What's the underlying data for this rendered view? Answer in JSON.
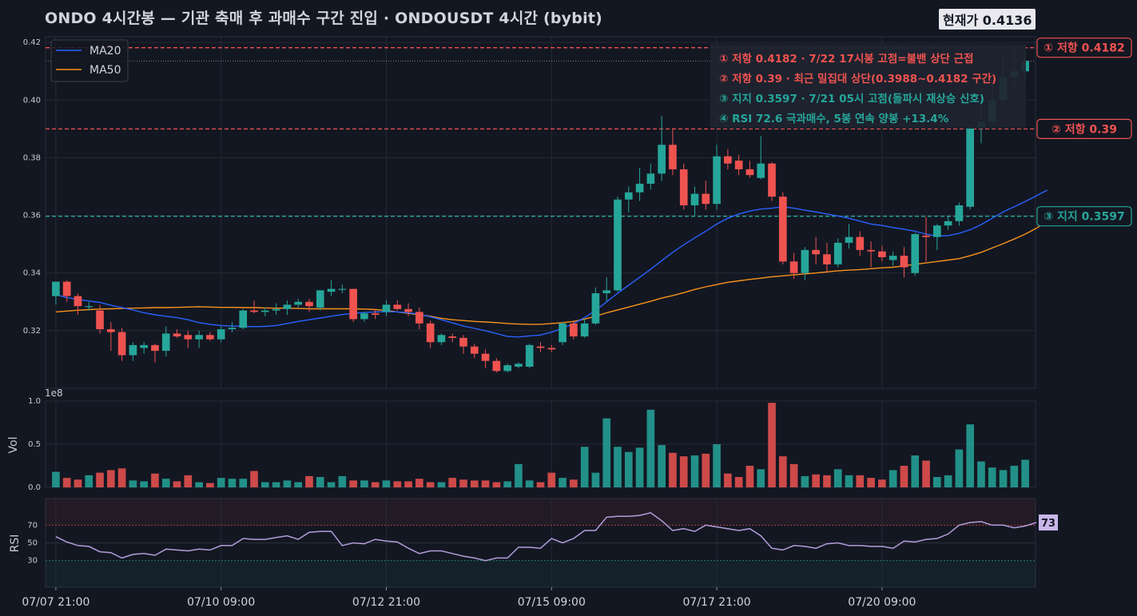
{
  "header": {
    "title": "ONDO 4시간봉 — 기관 축매 후 과매수 구간 진입   ·   ONDOUSDT 4시간 (bybit)",
    "current_price_label": "현재가 0.4136"
  },
  "colors": {
    "background": "#131722",
    "up": "#26a69a",
    "down": "#ef5350",
    "ma20": "#2962ff",
    "ma50": "#f7931a",
    "rsi_line": "#b39ddb",
    "resistance": "#ef5350",
    "support": "#26a69a"
  },
  "legend": {
    "ma20": "MA20",
    "ma50": "MA50"
  },
  "annotations": [
    {
      "text": "① 저항 0.4182 · 7/22 17시봉 고점=불밴 상단 근접",
      "color": "#ef5350"
    },
    {
      "text": "② 저항 0.39 · 최근 밀집대 상단(0.3988~0.4182 구간)",
      "color": "#ef5350"
    },
    {
      "text": "③ 지지 0.3597 · 7/21 05시 고점(돌파시 재상승 신호)",
      "color": "#26a69a"
    },
    {
      "text": "④ RSI 72.6 극과매수, 5봉 연속 양봉 +13.4%",
      "color": "#26a69a"
    }
  ],
  "level_labels": [
    {
      "text": "① 저항 0.4182",
      "value": 0.4182,
      "color": "#ef5350"
    },
    {
      "text": "② 저항 0.39",
      "value": 0.39,
      "color": "#ef5350"
    },
    {
      "text": "③ 지지 0.3597",
      "value": 0.3597,
      "color": "#26a69a"
    }
  ],
  "chart_data": {
    "type": "candlestick",
    "symbol": "ONDOUSDT",
    "timeframe": "4시간",
    "exchange": "bybit",
    "x_tick_labels": [
      "07/07 21:00",
      "07/10 09:00",
      "07/12 21:00",
      "07/15 09:00",
      "07/17 21:00",
      "07/20 09:00"
    ],
    "x_tick_indices": [
      0,
      15,
      30,
      45,
      60,
      75
    ],
    "price_axis": {
      "ylim": [
        0.3,
        0.422
      ],
      "ticks": [
        0.32,
        0.34,
        0.36,
        0.38,
        0.4,
        0.42
      ],
      "tick_labels": [
        "0.32",
        "0.34",
        "0.36",
        "0.38",
        "0.40",
        "0.42"
      ]
    },
    "volume_axis": {
      "label": "Vol",
      "multiplier_label": "1e8",
      "ylim": [
        0,
        1.0
      ],
      "ticks": [
        0,
        0.5,
        1.0
      ],
      "tick_labels": [
        "0.0",
        "0.5",
        "1.0"
      ]
    },
    "rsi_axis": {
      "label": "RSI",
      "ylim": [
        0,
        100
      ],
      "ticks": [
        30,
        50,
        70
      ],
      "tick_labels": [
        "30",
        "50",
        "70"
      ],
      "overbought": 70,
      "oversold": 30
    },
    "rsi_last_label": "73",
    "horizontal_levels": [
      {
        "value": 0.4182,
        "kind": "resistance"
      },
      {
        "value": 0.39,
        "kind": "resistance"
      },
      {
        "value": 0.3597,
        "kind": "support"
      }
    ],
    "candles": [
      {
        "o": 0.332,
        "h": 0.337,
        "l": 0.329,
        "c": 0.337
      },
      {
        "o": 0.337,
        "h": 0.3375,
        "l": 0.33,
        "c": 0.332
      },
      {
        "o": 0.332,
        "h": 0.333,
        "l": 0.3255,
        "c": 0.3285
      },
      {
        "o": 0.3285,
        "h": 0.33,
        "l": 0.327,
        "c": 0.3285
      },
      {
        "o": 0.327,
        "h": 0.329,
        "l": 0.319,
        "c": 0.3205
      },
      {
        "o": 0.3205,
        "h": 0.323,
        "l": 0.313,
        "c": 0.3195
      },
      {
        "o": 0.3195,
        "h": 0.321,
        "l": 0.3095,
        "c": 0.3115
      },
      {
        "o": 0.3115,
        "h": 0.316,
        "l": 0.3095,
        "c": 0.315
      },
      {
        "o": 0.314,
        "h": 0.316,
        "l": 0.312,
        "c": 0.315
      },
      {
        "o": 0.315,
        "h": 0.3155,
        "l": 0.309,
        "c": 0.313
      },
      {
        "o": 0.313,
        "h": 0.3215,
        "l": 0.311,
        "c": 0.319
      },
      {
        "o": 0.319,
        "h": 0.3205,
        "l": 0.3175,
        "c": 0.318
      },
      {
        "o": 0.3185,
        "h": 0.32,
        "l": 0.314,
        "c": 0.317
      },
      {
        "o": 0.317,
        "h": 0.32,
        "l": 0.314,
        "c": 0.3185
      },
      {
        "o": 0.3185,
        "h": 0.3195,
        "l": 0.3165,
        "c": 0.317
      },
      {
        "o": 0.317,
        "h": 0.3215,
        "l": 0.316,
        "c": 0.3205
      },
      {
        "o": 0.3205,
        "h": 0.323,
        "l": 0.3195,
        "c": 0.321
      },
      {
        "o": 0.321,
        "h": 0.3275,
        "l": 0.3205,
        "c": 0.327
      },
      {
        "o": 0.327,
        "h": 0.3305,
        "l": 0.326,
        "c": 0.3265
      },
      {
        "o": 0.3265,
        "h": 0.328,
        "l": 0.325,
        "c": 0.327
      },
      {
        "o": 0.327,
        "h": 0.3295,
        "l": 0.3255,
        "c": 0.3275
      },
      {
        "o": 0.3275,
        "h": 0.3305,
        "l": 0.3255,
        "c": 0.329
      },
      {
        "o": 0.329,
        "h": 0.331,
        "l": 0.328,
        "c": 0.33
      },
      {
        "o": 0.33,
        "h": 0.331,
        "l": 0.3265,
        "c": 0.3285
      },
      {
        "o": 0.328,
        "h": 0.334,
        "l": 0.327,
        "c": 0.334
      },
      {
        "o": 0.3335,
        "h": 0.3375,
        "l": 0.332,
        "c": 0.3345
      },
      {
        "o": 0.3345,
        "h": 0.336,
        "l": 0.333,
        "c": 0.3345
      },
      {
        "o": 0.3345,
        "h": 0.3345,
        "l": 0.323,
        "c": 0.324
      },
      {
        "o": 0.324,
        "h": 0.3265,
        "l": 0.323,
        "c": 0.326
      },
      {
        "o": 0.326,
        "h": 0.3275,
        "l": 0.324,
        "c": 0.3255
      },
      {
        "o": 0.3265,
        "h": 0.3305,
        "l": 0.325,
        "c": 0.329
      },
      {
        "o": 0.329,
        "h": 0.3305,
        "l": 0.327,
        "c": 0.3275
      },
      {
        "o": 0.3275,
        "h": 0.3295,
        "l": 0.325,
        "c": 0.3265
      },
      {
        "o": 0.3265,
        "h": 0.328,
        "l": 0.3205,
        "c": 0.3225
      },
      {
        "o": 0.3225,
        "h": 0.3235,
        "l": 0.314,
        "c": 0.316
      },
      {
        "o": 0.316,
        "h": 0.319,
        "l": 0.315,
        "c": 0.3185
      },
      {
        "o": 0.318,
        "h": 0.319,
        "l": 0.316,
        "c": 0.3175
      },
      {
        "o": 0.3175,
        "h": 0.3185,
        "l": 0.312,
        "c": 0.3145
      },
      {
        "o": 0.3145,
        "h": 0.3155,
        "l": 0.3105,
        "c": 0.312
      },
      {
        "o": 0.312,
        "h": 0.3135,
        "l": 0.307,
        "c": 0.3095
      },
      {
        "o": 0.3095,
        "h": 0.3105,
        "l": 0.3055,
        "c": 0.306
      },
      {
        "o": 0.306,
        "h": 0.3085,
        "l": 0.3055,
        "c": 0.308
      },
      {
        "o": 0.3075,
        "h": 0.309,
        "l": 0.307,
        "c": 0.3085
      },
      {
        "o": 0.3075,
        "h": 0.3155,
        "l": 0.307,
        "c": 0.315
      },
      {
        "o": 0.3145,
        "h": 0.316,
        "l": 0.3125,
        "c": 0.314
      },
      {
        "o": 0.314,
        "h": 0.315,
        "l": 0.3125,
        "c": 0.3135
      },
      {
        "o": 0.316,
        "h": 0.323,
        "l": 0.315,
        "c": 0.3225
      },
      {
        "o": 0.3225,
        "h": 0.3235,
        "l": 0.317,
        "c": 0.318
      },
      {
        "o": 0.318,
        "h": 0.324,
        "l": 0.3175,
        "c": 0.3225
      },
      {
        "o": 0.3225,
        "h": 0.335,
        "l": 0.322,
        "c": 0.333
      },
      {
        "o": 0.333,
        "h": 0.3385,
        "l": 0.33,
        "c": 0.334
      },
      {
        "o": 0.334,
        "h": 0.3665,
        "l": 0.3335,
        "c": 0.3655
      },
      {
        "o": 0.3655,
        "h": 0.37,
        "l": 0.361,
        "c": 0.368
      },
      {
        "o": 0.368,
        "h": 0.3765,
        "l": 0.365,
        "c": 0.371
      },
      {
        "o": 0.371,
        "h": 0.378,
        "l": 0.369,
        "c": 0.3745
      },
      {
        "o": 0.3745,
        "h": 0.3945,
        "l": 0.372,
        "c": 0.3845
      },
      {
        "o": 0.3845,
        "h": 0.39,
        "l": 0.374,
        "c": 0.376
      },
      {
        "o": 0.376,
        "h": 0.378,
        "l": 0.362,
        "c": 0.3635
      },
      {
        "o": 0.3635,
        "h": 0.37,
        "l": 0.36,
        "c": 0.3675
      },
      {
        "o": 0.3675,
        "h": 0.372,
        "l": 0.362,
        "c": 0.364
      },
      {
        "o": 0.364,
        "h": 0.3845,
        "l": 0.362,
        "c": 0.3805
      },
      {
        "o": 0.3805,
        "h": 0.383,
        "l": 0.376,
        "c": 0.378
      },
      {
        "o": 0.379,
        "h": 0.381,
        "l": 0.374,
        "c": 0.376
      },
      {
        "o": 0.376,
        "h": 0.379,
        "l": 0.373,
        "c": 0.374
      },
      {
        "o": 0.373,
        "h": 0.3875,
        "l": 0.3725,
        "c": 0.378
      },
      {
        "o": 0.378,
        "h": 0.3785,
        "l": 0.365,
        "c": 0.3665
      },
      {
        "o": 0.3665,
        "h": 0.368,
        "l": 0.343,
        "c": 0.344
      },
      {
        "o": 0.344,
        "h": 0.347,
        "l": 0.338,
        "c": 0.34
      },
      {
        "o": 0.34,
        "h": 0.349,
        "l": 0.3375,
        "c": 0.348
      },
      {
        "o": 0.348,
        "h": 0.3525,
        "l": 0.343,
        "c": 0.3465
      },
      {
        "o": 0.3465,
        "h": 0.3505,
        "l": 0.34,
        "c": 0.343
      },
      {
        "o": 0.343,
        "h": 0.352,
        "l": 0.342,
        "c": 0.3505
      },
      {
        "o": 0.3505,
        "h": 0.357,
        "l": 0.3485,
        "c": 0.3525
      },
      {
        "o": 0.3525,
        "h": 0.3545,
        "l": 0.346,
        "c": 0.348
      },
      {
        "o": 0.348,
        "h": 0.351,
        "l": 0.342,
        "c": 0.3475
      },
      {
        "o": 0.3475,
        "h": 0.3495,
        "l": 0.344,
        "c": 0.3455
      },
      {
        "o": 0.3445,
        "h": 0.3475,
        "l": 0.3425,
        "c": 0.346
      },
      {
        "o": 0.346,
        "h": 0.349,
        "l": 0.3385,
        "c": 0.342
      },
      {
        "o": 0.34,
        "h": 0.354,
        "l": 0.339,
        "c": 0.3535
      },
      {
        "o": 0.353,
        "h": 0.3595,
        "l": 0.344,
        "c": 0.3525
      },
      {
        "o": 0.3525,
        "h": 0.357,
        "l": 0.348,
        "c": 0.3565
      },
      {
        "o": 0.3565,
        "h": 0.36,
        "l": 0.355,
        "c": 0.358
      },
      {
        "o": 0.358,
        "h": 0.3645,
        "l": 0.3565,
        "c": 0.3635
      },
      {
        "o": 0.363,
        "h": 0.391,
        "l": 0.362,
        "c": 0.3905
      },
      {
        "o": 0.3905,
        "h": 0.399,
        "l": 0.385,
        "c": 0.3925
      },
      {
        "o": 0.3925,
        "h": 0.406,
        "l": 0.39,
        "c": 0.4
      },
      {
        "o": 0.4,
        "h": 0.416,
        "l": 0.399,
        "c": 0.408
      },
      {
        "o": 0.408,
        "h": 0.4182,
        "l": 0.404,
        "c": 0.41
      },
      {
        "o": 0.41,
        "h": 0.417,
        "l": 0.406,
        "c": 0.4136
      }
    ],
    "ma20": [
      0.3325,
      0.3315,
      0.3308,
      0.3303,
      0.3298,
      0.3288,
      0.328,
      0.3272,
      0.3262,
      0.3255,
      0.325,
      0.3245,
      0.3238,
      0.3228,
      0.3222,
      0.3218,
      0.3216,
      0.3215,
      0.3214,
      0.3215,
      0.3218,
      0.3225,
      0.3232,
      0.3238,
      0.3244,
      0.325,
      0.3256,
      0.326,
      0.3263,
      0.3265,
      0.3266,
      0.3265,
      0.3262,
      0.3257,
      0.3248,
      0.3238,
      0.3227,
      0.3216,
      0.3208,
      0.32,
      0.319,
      0.318,
      0.3178,
      0.3182,
      0.3185,
      0.3195,
      0.3208,
      0.3225,
      0.3245,
      0.327,
      0.33,
      0.333,
      0.3358,
      0.3385,
      0.3413,
      0.3443,
      0.3472,
      0.3498,
      0.3522,
      0.3545,
      0.357,
      0.359,
      0.3605,
      0.3615,
      0.3622,
      0.3625,
      0.363,
      0.3625,
      0.3618,
      0.3612,
      0.3605,
      0.3598,
      0.359,
      0.358,
      0.357,
      0.3565,
      0.3558,
      0.3552,
      0.3545,
      0.3535,
      0.3528,
      0.353,
      0.3538,
      0.355,
      0.3568,
      0.359,
      0.3612,
      0.363,
      0.3648,
      0.3668,
      0.3688
    ],
    "ma50": [
      0.3265,
      0.3268,
      0.3271,
      0.3273,
      0.3275,
      0.3276,
      0.3277,
      0.3278,
      0.3279,
      0.328,
      0.328,
      0.3281,
      0.3282,
      0.3283,
      0.3282,
      0.3281,
      0.3281,
      0.328,
      0.328,
      0.3279,
      0.3278,
      0.3278,
      0.3277,
      0.3276,
      0.3276,
      0.3276,
      0.3276,
      0.3276,
      0.3275,
      0.3273,
      0.327,
      0.3265,
      0.326,
      0.3255,
      0.325,
      0.3243,
      0.3238,
      0.3235,
      0.3232,
      0.323,
      0.3228,
      0.3225,
      0.3223,
      0.3222,
      0.3222,
      0.3225,
      0.3228,
      0.3232,
      0.324,
      0.325,
      0.3262,
      0.3272,
      0.3282,
      0.3292,
      0.3302,
      0.3313,
      0.3322,
      0.3332,
      0.3343,
      0.3352,
      0.336,
      0.3368,
      0.3373,
      0.3378,
      0.3382,
      0.3387,
      0.339,
      0.3394,
      0.3397,
      0.34,
      0.3404,
      0.3408,
      0.341,
      0.3412,
      0.3415,
      0.3418,
      0.342,
      0.3425,
      0.343,
      0.3435,
      0.344,
      0.3445,
      0.345,
      0.346,
      0.3472,
      0.3487,
      0.3502,
      0.3518,
      0.3535,
      0.3555,
      0.358
    ],
    "volume": [
      0.18,
      0.11,
      0.09,
      0.14,
      0.17,
      0.2,
      0.22,
      0.08,
      0.07,
      0.16,
      0.1,
      0.07,
      0.14,
      0.06,
      0.05,
      0.11,
      0.1,
      0.1,
      0.19,
      0.06,
      0.06,
      0.08,
      0.06,
      0.13,
      0.12,
      0.06,
      0.13,
      0.08,
      0.08,
      0.06,
      0.08,
      0.07,
      0.07,
      0.1,
      0.06,
      0.06,
      0.11,
      0.09,
      0.08,
      0.08,
      0.06,
      0.07,
      0.27,
      0.08,
      0.06,
      0.17,
      0.11,
      0.09,
      0.47,
      0.17,
      0.8,
      0.47,
      0.41,
      0.46,
      0.9,
      0.49,
      0.4,
      0.36,
      0.37,
      0.39,
      0.5,
      0.16,
      0.12,
      0.25,
      0.21,
      0.98,
      0.36,
      0.27,
      0.13,
      0.15,
      0.14,
      0.21,
      0.14,
      0.14,
      0.11,
      0.09,
      0.2,
      0.25,
      0.37,
      0.31,
      0.12,
      0.14,
      0.44,
      0.73,
      0.3,
      0.23,
      0.2,
      0.25,
      0.32,
      0.34
    ],
    "rsi": [
      57,
      51,
      47,
      46,
      40,
      39,
      33,
      37,
      38,
      36,
      43,
      42,
      41,
      43,
      42,
      47,
      47,
      55,
      54,
      54,
      56,
      58,
      54,
      62,
      63,
      63,
      47,
      50,
      49,
      54,
      52,
      51,
      44,
      38,
      41,
      41,
      38,
      35,
      33,
      30,
      33,
      33,
      45,
      45,
      44,
      55,
      50,
      55,
      64,
      64,
      79,
      80,
      80,
      81,
      84,
      75,
      64,
      66,
      63,
      70,
      68,
      66,
      64,
      66,
      58,
      44,
      42,
      47,
      46,
      44,
      49,
      50,
      47,
      47,
      46,
      46,
      44,
      52,
      51,
      54,
      55,
      60,
      70,
      73,
      74,
      70,
      70,
      67,
      69,
      73
    ]
  }
}
